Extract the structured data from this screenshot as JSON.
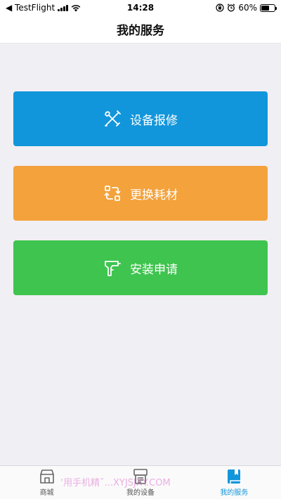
{
  "status_bar": {
    "back_app": "◀ TestFlight",
    "time": "14:28",
    "battery_percent": "60%",
    "battery_level": 0.6
  },
  "nav": {
    "title": "我的服务"
  },
  "actions": [
    {
      "label": "设备报修",
      "icon": "tools-icon",
      "color": "#1296db"
    },
    {
      "label": "更换耗材",
      "icon": "replace-icon",
      "color": "#f4a23c"
    },
    {
      "label": "安装申请",
      "icon": "drill-icon",
      "color": "#3fc44f"
    }
  ],
  "tabs": [
    {
      "label": "商城",
      "icon": "store-icon",
      "active": false
    },
    {
      "label": "我的设备",
      "icon": "device-icon",
      "active": false
    },
    {
      "label": "我的服务",
      "icon": "service-book-icon",
      "active": true
    }
  ],
  "watermark": "ʼ用手机精ˇ...XYJSJXY.COM"
}
